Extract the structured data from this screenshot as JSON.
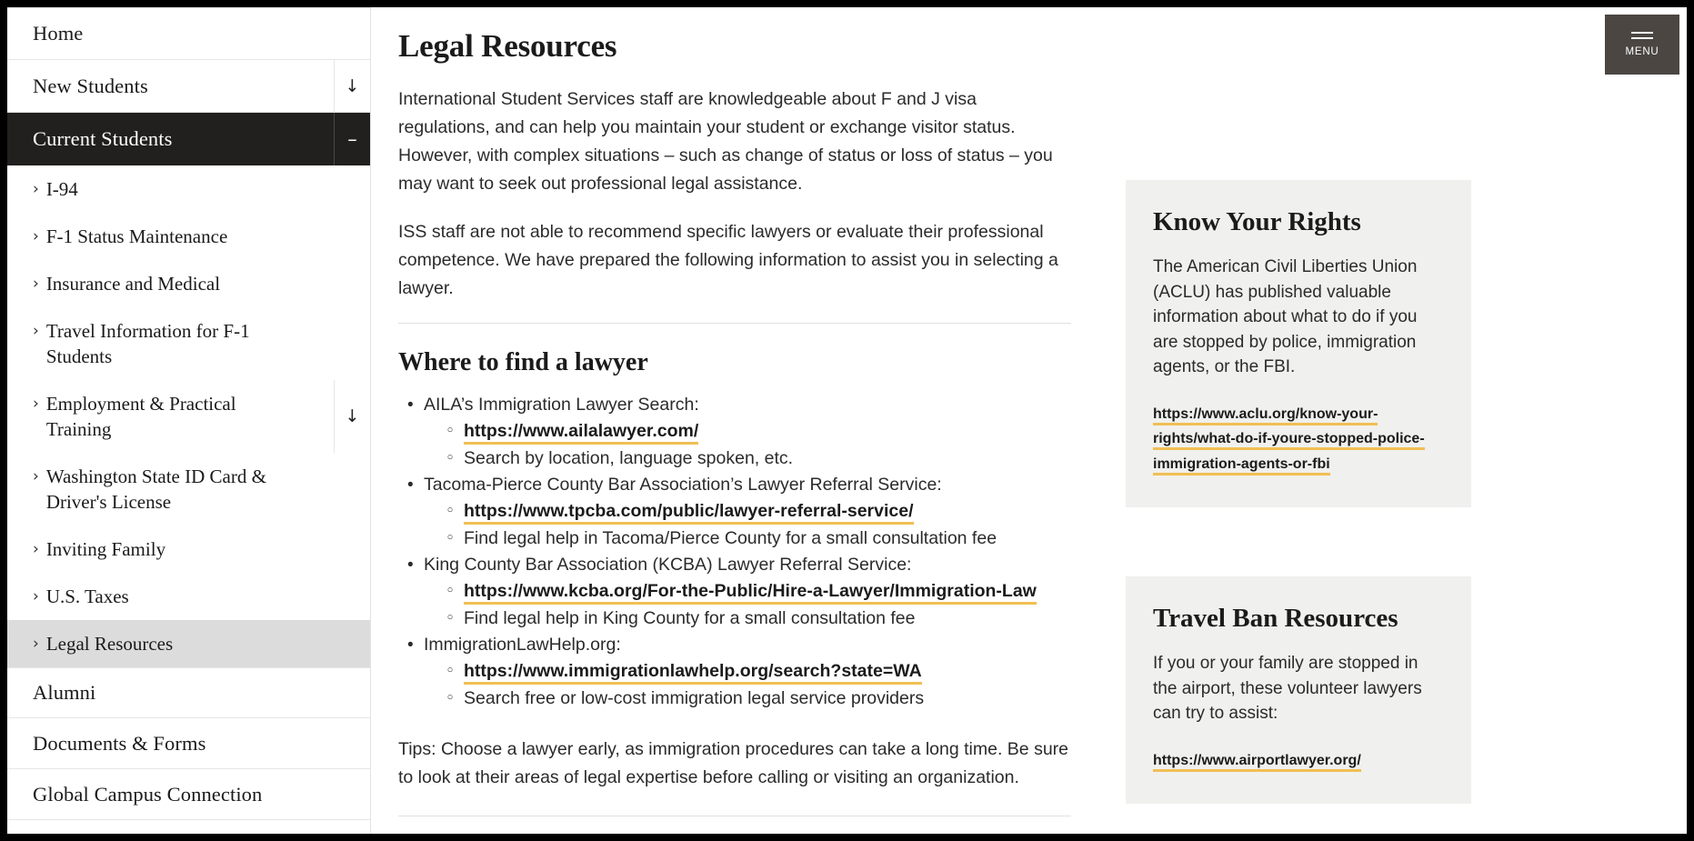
{
  "colors": {
    "accent_underline": "#f1bf54",
    "active_nav_bg": "#221f1f",
    "highlight_nav_bg": "#dcdcdc",
    "callout_bg": "#f0f0ee",
    "menu_button_bg": "#4b4642"
  },
  "menu_button": {
    "label": "MENU"
  },
  "sidebar": {
    "top_items": [
      {
        "label": "Home",
        "toggle": ""
      },
      {
        "label": "New Students",
        "toggle": "↓"
      },
      {
        "label": "Current Students",
        "toggle": "–",
        "active": true
      }
    ],
    "sub_items": [
      {
        "label": "I-94",
        "chevron": "›",
        "toggle": ""
      },
      {
        "label": "F-1 Status Maintenance",
        "chevron": "›",
        "toggle": ""
      },
      {
        "label": "Insurance and Medical",
        "chevron": "›",
        "toggle": ""
      },
      {
        "label": "Travel Information for F-1 Students",
        "chevron": "›",
        "toggle": ""
      },
      {
        "label": "Employment & Practical Training",
        "chevron": "›",
        "toggle": "↓"
      },
      {
        "label": "Washington State ID Card & Driver's License",
        "chevron": "›",
        "toggle": ""
      },
      {
        "label": "Inviting Family",
        "chevron": "›",
        "toggle": ""
      },
      {
        "label": "U.S. Taxes",
        "chevron": "›",
        "toggle": ""
      },
      {
        "label": "Legal Resources",
        "chevron": "›",
        "toggle": "",
        "highlight": true
      }
    ],
    "bottom_items": [
      {
        "label": "Alumni"
      },
      {
        "label": "Documents & Forms"
      },
      {
        "label": "Global Campus Connection"
      }
    ]
  },
  "main": {
    "title": "Legal Resources",
    "paragraph_1": "International Student Services staff are knowledgeable about F and J visa regulations, and can help you maintain your student or exchange visitor status. However, with complex situations – such as change of status or loss of status – you may want to seek out professional legal assistance.",
    "paragraph_2": "ISS staff are not able to recommend specific lawyers or evaluate their professional competence. We have prepared the following information to assist you in selecting a lawyer.",
    "section_title": "Where to find a lawyer",
    "resources": [
      {
        "label": "AILA’s Immigration Lawyer Search:",
        "link": "https://www.ailalawyer.com/",
        "note": "Search by location, language spoken, etc."
      },
      {
        "label": "Tacoma-Pierce County Bar Association’s Lawyer Referral Service:",
        "link": "https://www.tpcba.com/public/lawyer-referral-service/",
        "note": "Find legal help in Tacoma/Pierce County for a small consultation fee"
      },
      {
        "label": "King County Bar Association (KCBA) Lawyer Referral Service:",
        "link": "https://www.kcba.org/For-the-Public/Hire-a-Lawyer/Immigration-Law",
        "note": "Find legal help in King County for a small consultation fee"
      },
      {
        "label": "ImmigrationLawHelp.org:",
        "link": "https://www.immigrationlawhelp.org/search?state=WA",
        "note": "Search free or low-cost immigration legal service providers"
      }
    ],
    "tips": "Tips: Choose a lawyer early, as immigration procedures can take a long time. Be sure to look at their areas of legal expertise before calling or visiting an organization."
  },
  "rail": {
    "callouts": [
      {
        "title": "Know Your Rights",
        "body": "The American Civil Liberties Union (ACLU) has published valuable information about what to do if you are stopped by police, immigration agents, or the FBI.",
        "link": "https://www.aclu.org/know-your-rights/what-do-if-youre-stopped-police-immigration-agents-or-fbi"
      },
      {
        "title": "Travel Ban Resources",
        "body": "If you or your family are stopped in the airport, these volunteer lawyers can try to assist:",
        "link": "https://www.airportlawyer.org/"
      }
    ]
  }
}
